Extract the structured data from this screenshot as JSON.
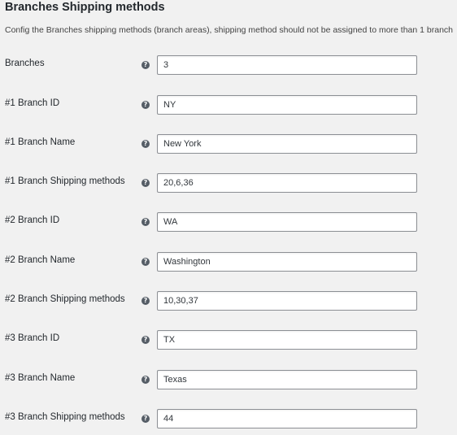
{
  "section": {
    "title": "Branches Shipping methods",
    "description": "Config the Branches shipping methods (branch areas), shipping method should not be assigned to more than 1 branch"
  },
  "help_icon": {
    "glyph": "?",
    "icon_name": "help-icon"
  },
  "fields": [
    {
      "label": "Branches",
      "value": "3"
    },
    {
      "label": "#1 Branch ID",
      "value": "NY"
    },
    {
      "label": "#1 Branch Name",
      "value": "New York"
    },
    {
      "label": "#1 Branch Shipping methods",
      "value": "20,6,36"
    },
    {
      "label": "#2 Branch ID",
      "value": "WA"
    },
    {
      "label": "#2 Branch Name",
      "value": "Washington"
    },
    {
      "label": "#2 Branch Shipping methods",
      "value": "10,30,37"
    },
    {
      "label": "#3 Branch ID",
      "value": "TX"
    },
    {
      "label": "#3 Branch Name",
      "value": "Texas"
    },
    {
      "label": "#3 Branch Shipping methods",
      "value": "44"
    }
  ]
}
